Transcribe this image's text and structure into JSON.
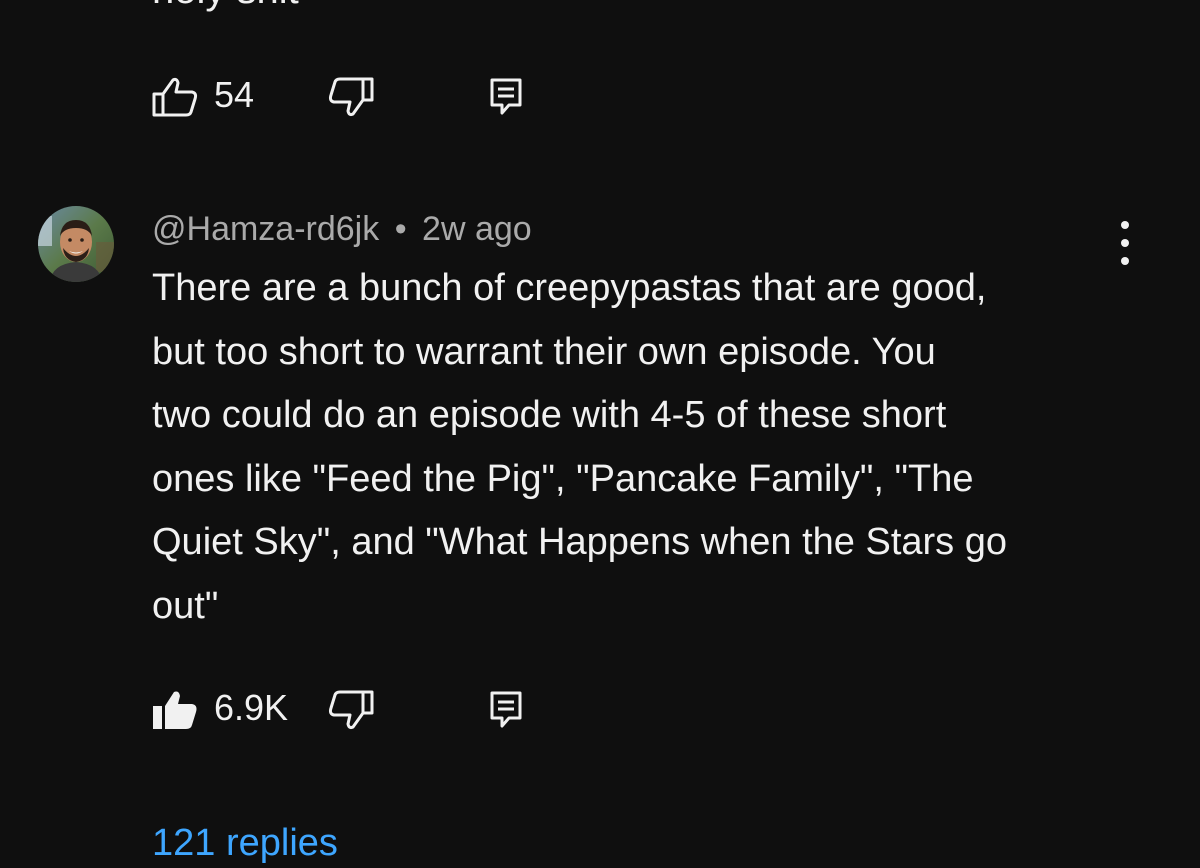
{
  "previous_comment": {
    "text_fragment": "holy shit",
    "likes": "54"
  },
  "comment": {
    "author": "@Hamza-rd6jk",
    "separator": "•",
    "time_ago": "2w ago",
    "lines": [
      "There are a bunch of creepypastas that are good,",
      "but too short to warrant their own episode. You",
      "two could do an episode with 4-5 of these short",
      "ones like \"Feed the Pig\", \"Pancake Family\", \"The",
      "Quiet Sky\", and \"What Happens when the Stars go",
      "out\""
    ],
    "likes": "6.9K",
    "liked": true,
    "replies_label": "121 replies"
  },
  "icons": {
    "like": "thumbs-up-icon",
    "dislike": "thumbs-down-icon",
    "reply": "comment-reply-icon",
    "more": "more-vertical-icon"
  },
  "colors": {
    "background": "#0f0f0f",
    "text": "#f1f1f1",
    "secondary_text": "#aaaaaa",
    "link": "#3ea6ff"
  }
}
